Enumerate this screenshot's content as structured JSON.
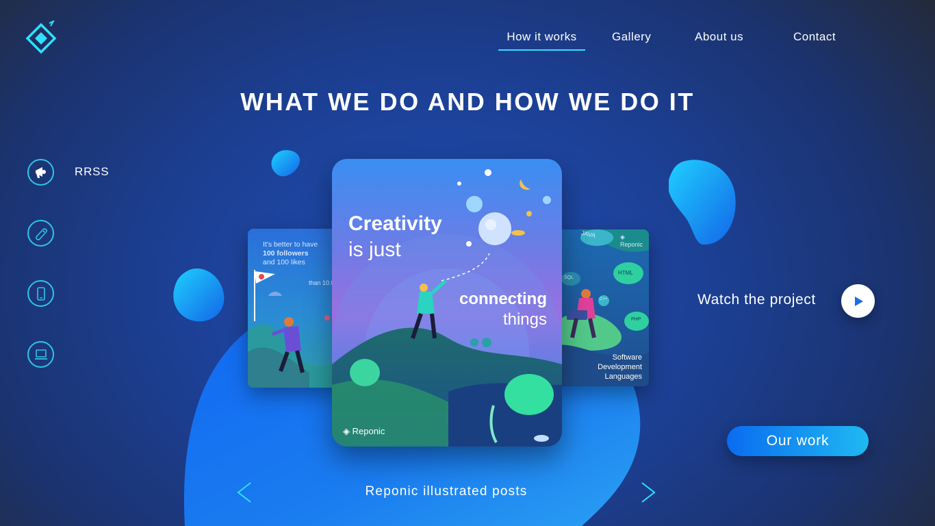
{
  "brand": {
    "logo_icon": "diamond-logo-icon",
    "accent": "#2fe1ff"
  },
  "nav": {
    "items": [
      {
        "label": "How it works",
        "active": true
      },
      {
        "label": "Gallery",
        "active": false
      },
      {
        "label": "About us",
        "active": false
      },
      {
        "label": "Contact",
        "active": false
      }
    ]
  },
  "hero": {
    "title": "WHAT WE DO AND HOW WE DO IT"
  },
  "sidebar": {
    "items": [
      {
        "icon": "megaphone-icon",
        "label": "RRSS",
        "active": true
      },
      {
        "icon": "tag-icon",
        "label": "",
        "active": false
      },
      {
        "icon": "phone-icon",
        "label": "",
        "active": false
      },
      {
        "icon": "laptop-icon",
        "label": "",
        "active": false
      }
    ]
  },
  "carousel": {
    "caption": "Reponic illustrated posts",
    "prev_icon": "chevron-left-icon",
    "next_icon": "chevron-right-icon",
    "main_card": {
      "line1": "Creativity",
      "line2": "is just",
      "line3": "connecting",
      "line4": "things",
      "brand": "Reponic"
    },
    "left_card": {
      "line1": "It's better to have",
      "line2": "100 followers",
      "line3": "and 100 likes",
      "line4": "than 10.0"
    },
    "right_card": {
      "brand": "Reponic",
      "line1": "Software",
      "line2": "Development",
      "line3": "Languages",
      "tags": [
        "JAVA",
        "HTML",
        "SQL",
        "C++",
        "PHP"
      ]
    }
  },
  "watch": {
    "label": "Watch the project",
    "icon": "play-icon"
  },
  "cta": {
    "label": "Our work"
  }
}
